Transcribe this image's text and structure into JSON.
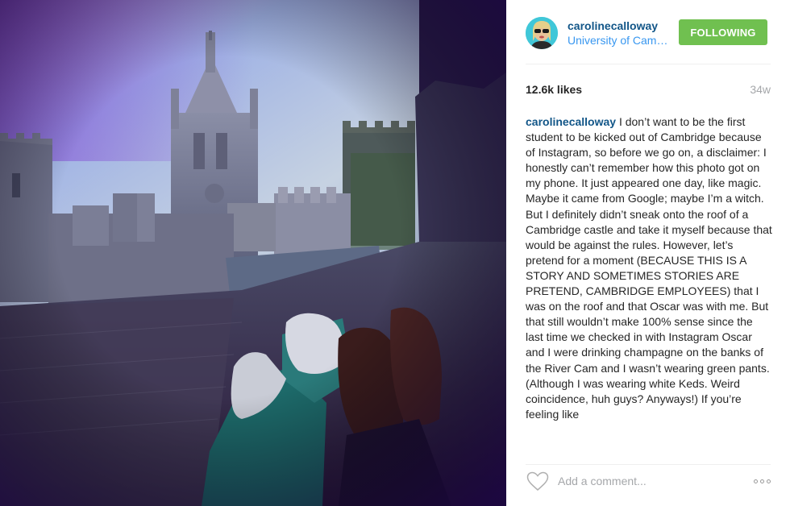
{
  "post": {
    "username": "carolinecalloway",
    "location": "University of Cambridge",
    "follow_label": "FOLLOWING",
    "likes": "12.6k likes",
    "age": "34w",
    "caption_user": "carolinecalloway",
    "caption_text": " I don’t want to be the first student to be kicked out of Cambridge because of Instagram, so before we go on, a disclaimer: I honestly can’t remember how this photo got on my phone. It just appeared one day, like magic. Maybe it came from Google; maybe I’m a witch. But I definitely didn’t sneak onto the roof of a Cambridge castle and take it myself because that would be against the rules. However, let’s pretend for a moment (BECAUSE THIS IS A STORY AND SOMETIMES STORIES ARE PRETEND, CAMBRIDGE EMPLOYEES) that I was on the roof and that Oscar was with me. But that still wouldn’t make 100% sense since the last time we checked in with Instagram Oscar and I were drinking champagne on the banks of the River Cam and I wasn’t wearing green pants. (Although I was wearing white Keds. Weird coincidence, huh guys? Anyways!) If you’re feeling like",
    "comment_placeholder": "Add a comment..."
  },
  "colors": {
    "username": "#125688",
    "location": "#3897f0",
    "follow_bg": "#70c050",
    "muted": "#a5a7aa",
    "avatar_bg": "#40c7d8"
  },
  "icons": {
    "heart": "heart-outline-icon",
    "more": "more-options-icon"
  }
}
